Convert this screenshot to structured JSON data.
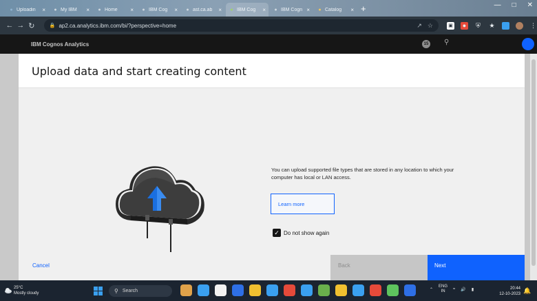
{
  "browser": {
    "tabs": [
      {
        "label": "Uploadin",
        "icon": "globe-icon",
        "icon_color": "#8fb3d1",
        "active": false
      },
      {
        "label": "My IBM",
        "icon": "ibm-icon",
        "icon_color": "#cfd8df",
        "active": false
      },
      {
        "label": "Home",
        "icon": "cognos-icon",
        "icon_color": "#cfd8df",
        "active": false
      },
      {
        "label": "IBM Cog",
        "icon": "ibm-icon",
        "icon_color": "#cfd8df",
        "active": false
      },
      {
        "label": "ast.ca.ab",
        "icon": "page-icon",
        "icon_color": "#cfd8df",
        "active": false
      },
      {
        "label": "IBM Cog",
        "icon": "check-icon",
        "icon_color": "#a0d46a",
        "active": true
      },
      {
        "label": "IBM Cogn",
        "icon": "ibm-icon",
        "icon_color": "#cfd8df",
        "active": false
      },
      {
        "label": "Catalog",
        "icon": "catalog-icon",
        "icon_color": "#f0c75e",
        "active": false
      }
    ],
    "new_tab": "+",
    "url": "ap2.ca.analytics.ibm.com/bi/?perspective=home"
  },
  "app": {
    "brand": "IBM Cognos Analytics",
    "notification_count": "15"
  },
  "dialog": {
    "title": "Upload data and start creating content",
    "description": "You can upload supported file types that are stored in any location to which your computer has local or LAN access.",
    "learn_more": "Learn more",
    "checkbox_label": "Do not show again",
    "checkbox_checked": true,
    "cancel": "Cancel",
    "back": "Back",
    "next": "Next"
  },
  "taskbar": {
    "weather_temp": "25°C",
    "weather_desc": "Mostly cloudy",
    "search_placeholder": "Search",
    "lang_top": "ENG",
    "lang_bottom": "IN",
    "time": "20:44",
    "date": "12-10-2023",
    "app_colors": [
      "#e0a24a",
      "#3aa0f0",
      "#f2f2f2",
      "#2e6fe6",
      "#f0c030",
      "#3aa0f0",
      "#e64a3a",
      "#3aa0f0",
      "#6ab04c",
      "#f0c030",
      "#3aa0f0",
      "#e64a3a",
      "#5ec45e",
      "#2e6fe6"
    ]
  }
}
